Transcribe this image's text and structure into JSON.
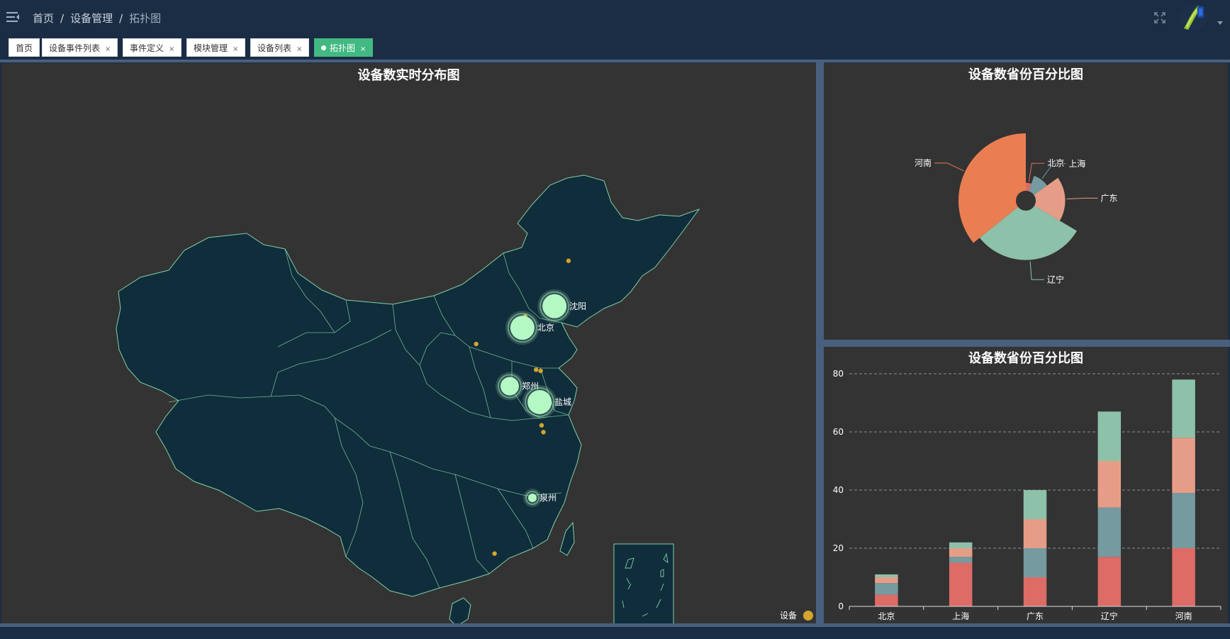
{
  "breadcrumb": {
    "home": "首页",
    "section": "设备管理",
    "current": "拓扑图",
    "separator": "/"
  },
  "tags": [
    {
      "label": "首页",
      "closable": false,
      "active": false
    },
    {
      "label": "设备事件列表",
      "closable": true,
      "active": false
    },
    {
      "label": "事件定义",
      "closable": true,
      "active": false
    },
    {
      "label": "模块管理",
      "closable": true,
      "active": false
    },
    {
      "label": "设备列表",
      "closable": true,
      "active": false
    },
    {
      "label": "拓扑图",
      "closable": true,
      "active": true
    }
  ],
  "tag_close_glyph": "×",
  "colors": {
    "header_bg": "#1b2d44",
    "panel_bg": "#333333",
    "map_fill": "#102d3b",
    "map_border": "#7fd0a6",
    "effect_point": "#b4f8c4",
    "minor_point": "#d4a52c",
    "active_tag": "#42b983",
    "series": [
      "#dd6b66",
      "#759aa0",
      "#e69d87",
      "#8dc1a9",
      "#ea7e53"
    ]
  },
  "icons": {
    "menu": "hamburger-icon",
    "fullscreen": "fullscreen-icon",
    "avatar": "avatar-image",
    "caret": "caret-down-icon"
  },
  "chart_data": [
    {
      "type": "map",
      "title": "设备数实时分布图",
      "legend": {
        "label": "设备",
        "position": "bottom-right"
      },
      "points": [
        {
          "name": "沈阳",
          "lng": 123.43,
          "lat": 41.8,
          "size": "large",
          "labeled": true
        },
        {
          "name": "北京",
          "lng": 116.4,
          "lat": 39.9,
          "size": "large",
          "labeled": true
        },
        {
          "name": "郑州",
          "lng": 113.62,
          "lat": 34.75,
          "size": "medium",
          "labeled": true
        },
        {
          "name": "盐城",
          "lng": 120.16,
          "lat": 33.35,
          "size": "large",
          "labeled": true
        },
        {
          "name": "泉州",
          "lng": 118.59,
          "lat": 24.91,
          "size": "small",
          "labeled": true
        }
      ],
      "minor_points": [
        {
          "lng": 106.27,
          "lat": 38.47
        },
        {
          "lng": 117.0,
          "lat": 40.9
        },
        {
          "lng": 126.5,
          "lat": 45.8
        },
        {
          "lng": 119.4,
          "lat": 36.2
        },
        {
          "lng": 120.4,
          "lat": 36.1
        },
        {
          "lng": 120.6,
          "lat": 31.3
        },
        {
          "lng": 121.0,
          "lat": 30.7
        },
        {
          "lng": 110.3,
          "lat": 20.0
        }
      ]
    },
    {
      "type": "pie",
      "subtype": "rose",
      "title": "设备数省份百分比图",
      "legend": "none",
      "labels_on_chart": true,
      "slices": [
        {
          "name": "北京",
          "value": 11
        },
        {
          "name": "上海",
          "value": 22
        },
        {
          "name": "广东",
          "value": 40
        },
        {
          "name": "辽宁",
          "value": 67
        },
        {
          "name": "河南",
          "value": 78
        }
      ]
    },
    {
      "type": "bar",
      "stacked": true,
      "title": "设备数省份百分比图",
      "legend": "none",
      "grid": true,
      "xlabel": "",
      "ylabel": "",
      "ylim": [
        0,
        80
      ],
      "yticks": [
        0,
        20,
        40,
        60,
        80
      ],
      "categories": [
        "北京",
        "上海",
        "广东",
        "辽宁",
        "河南"
      ],
      "series": [
        {
          "values": [
            4,
            15,
            10,
            17,
            20
          ]
        },
        {
          "values": [
            4,
            2,
            10,
            17,
            19
          ]
        },
        {
          "values": [
            2,
            3,
            10,
            16,
            19
          ]
        },
        {
          "values": [
            1,
            2,
            10,
            17,
            20
          ]
        }
      ]
    }
  ]
}
